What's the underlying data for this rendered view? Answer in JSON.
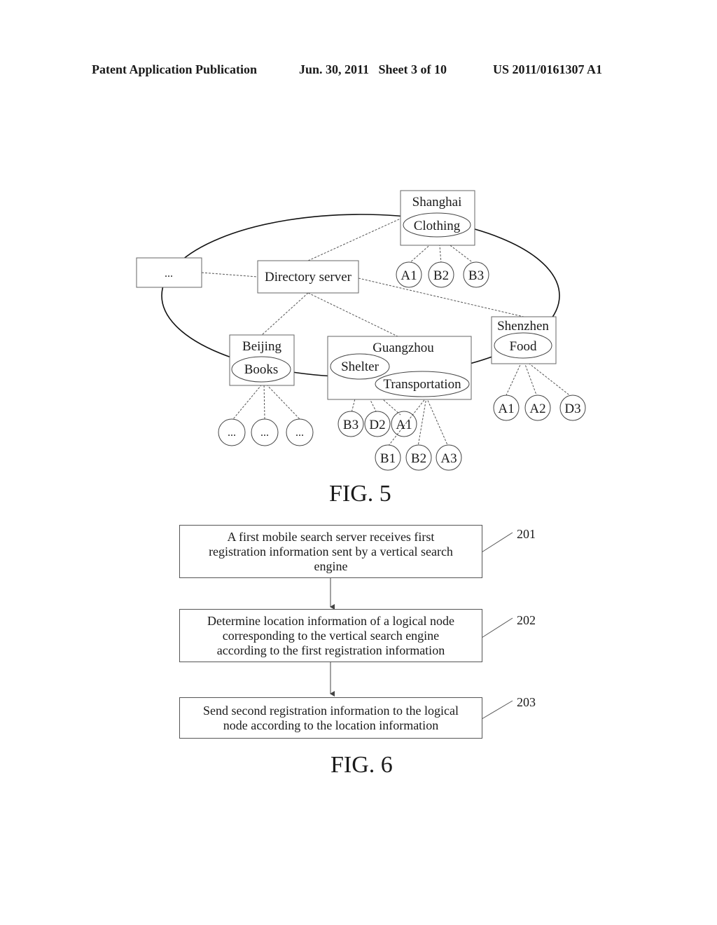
{
  "header": {
    "publication": "Patent Application Publication",
    "date_sheet": "Jun. 30, 2011   Sheet 3 of 10",
    "patent_number": "US 2011/0161307 A1"
  },
  "fig5": {
    "label": "FIG. 5",
    "directory_server": "Directory server",
    "other_node": "...",
    "nodes": {
      "shanghai": {
        "city": "Shanghai",
        "categories": [
          "Clothing"
        ],
        "engines": [
          "A1",
          "B2",
          "B3"
        ]
      },
      "beijing": {
        "city": "Beijing",
        "categories": [
          "Books"
        ],
        "engines": [
          "...",
          "...",
          "..."
        ]
      },
      "guangzhou": {
        "city": "Guangzhou",
        "categories": [
          "Shelter",
          "Transportation"
        ],
        "shelter_engines": [
          "B3",
          "D2",
          "A1"
        ],
        "transportation_engines": [
          "B1",
          "B2",
          "A3"
        ]
      },
      "shenzhen": {
        "city": "Shenzhen",
        "categories": [
          "Food"
        ],
        "engines": [
          "A1",
          "A2",
          "D3"
        ]
      }
    }
  },
  "fig6": {
    "label": "FIG. 6",
    "steps": [
      {
        "ref": "201",
        "lines": [
          "A first mobile search server receives first",
          "registration information sent by a vertical search",
          "engine"
        ]
      },
      {
        "ref": "202",
        "lines": [
          "Determine location information of a logical node",
          "corresponding to the vertical search engine",
          "according to the first registration information"
        ]
      },
      {
        "ref": "203",
        "lines": [
          "Send second registration information to the logical",
          "node according to the location information"
        ]
      }
    ]
  }
}
